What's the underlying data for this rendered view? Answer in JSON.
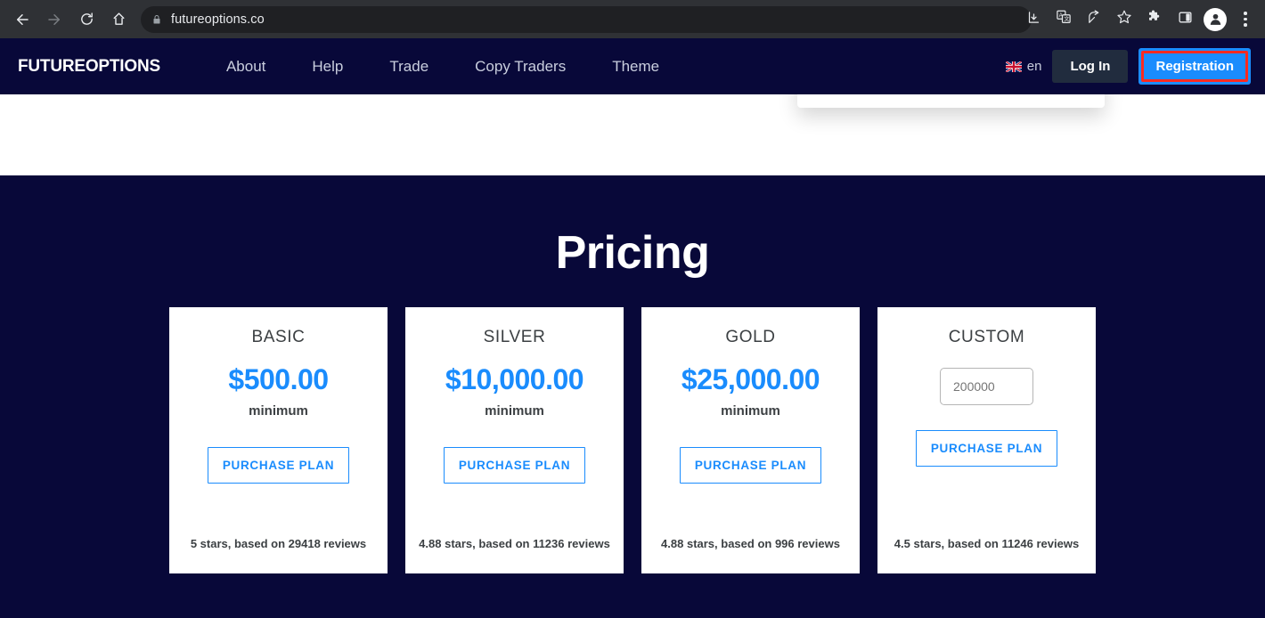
{
  "browser": {
    "back_icon": "back-arrow-icon",
    "forward_icon": "forward-arrow-icon",
    "reload_icon": "reload-icon",
    "home_icon": "home-icon",
    "url": "futureoptions.co",
    "lock_icon": "lock-icon",
    "toolbar_icons": [
      "download-icon",
      "translate-icon",
      "share-icon",
      "bookmark-star-icon",
      "extensions-puzzle-icon",
      "side-panel-icon",
      "profile-avatar-icon",
      "three-dot-menu-icon"
    ]
  },
  "site_nav": {
    "brand": "FUTUREOPTIONS",
    "links": [
      {
        "label": "About"
      },
      {
        "label": "Help"
      },
      {
        "label": "Trade"
      },
      {
        "label": "Copy Traders"
      },
      {
        "label": "Theme"
      }
    ],
    "language": {
      "code": "en",
      "flag_icon": "uk-flag-icon"
    },
    "login_label": "Log In",
    "registration_label": "Registration",
    "accent_color": "#1a8cfd",
    "highlight_color": "#ff2a20",
    "background_color": "#080839",
    "login_bg_color": "#212c3e"
  },
  "pricing": {
    "title": "Pricing",
    "purchase_label": "PURCHASE PLAN",
    "plans": [
      {
        "name": "BASIC",
        "price": "$500.00",
        "sub": "minimum",
        "reviews": "5 stars, based on 29418 reviews",
        "has_input": false
      },
      {
        "name": "SILVER",
        "price": "$10,000.00",
        "sub": "minimum",
        "reviews": "4.88 stars, based on 11236 reviews",
        "has_input": false
      },
      {
        "name": "GOLD",
        "price": "$25,000.00",
        "sub": "minimum",
        "reviews": "4.88 stars, based on 996 reviews",
        "has_input": false
      },
      {
        "name": "CUSTOM",
        "price": "",
        "sub": "",
        "reviews": "4.5 stars, based on 11246 reviews",
        "has_input": true,
        "input_value": "200000",
        "input_placeholder": "200000"
      }
    ]
  }
}
